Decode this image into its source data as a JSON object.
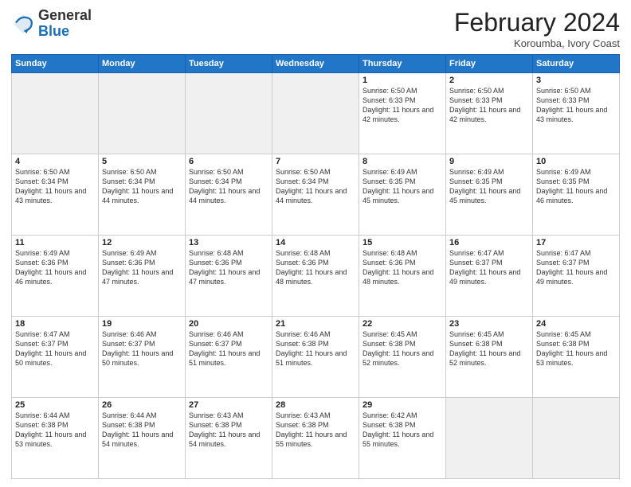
{
  "logo": {
    "general": "General",
    "blue": "Blue"
  },
  "header": {
    "month": "February 2024",
    "location": "Koroumba, Ivory Coast"
  },
  "days_of_week": [
    "Sunday",
    "Monday",
    "Tuesday",
    "Wednesday",
    "Thursday",
    "Friday",
    "Saturday"
  ],
  "weeks": [
    [
      {
        "day": "",
        "empty": true
      },
      {
        "day": "",
        "empty": true
      },
      {
        "day": "",
        "empty": true
      },
      {
        "day": "",
        "empty": true
      },
      {
        "day": "1",
        "sunrise": "6:50 AM",
        "sunset": "6:33 PM",
        "daylight": "11 hours and 42 minutes."
      },
      {
        "day": "2",
        "sunrise": "6:50 AM",
        "sunset": "6:33 PM",
        "daylight": "11 hours and 42 minutes."
      },
      {
        "day": "3",
        "sunrise": "6:50 AM",
        "sunset": "6:33 PM",
        "daylight": "11 hours and 43 minutes."
      }
    ],
    [
      {
        "day": "4",
        "sunrise": "6:50 AM",
        "sunset": "6:34 PM",
        "daylight": "11 hours and 43 minutes."
      },
      {
        "day": "5",
        "sunrise": "6:50 AM",
        "sunset": "6:34 PM",
        "daylight": "11 hours and 44 minutes."
      },
      {
        "day": "6",
        "sunrise": "6:50 AM",
        "sunset": "6:34 PM",
        "daylight": "11 hours and 44 minutes."
      },
      {
        "day": "7",
        "sunrise": "6:50 AM",
        "sunset": "6:34 PM",
        "daylight": "11 hours and 44 minutes."
      },
      {
        "day": "8",
        "sunrise": "6:49 AM",
        "sunset": "6:35 PM",
        "daylight": "11 hours and 45 minutes."
      },
      {
        "day": "9",
        "sunrise": "6:49 AM",
        "sunset": "6:35 PM",
        "daylight": "11 hours and 45 minutes."
      },
      {
        "day": "10",
        "sunrise": "6:49 AM",
        "sunset": "6:35 PM",
        "daylight": "11 hours and 46 minutes."
      }
    ],
    [
      {
        "day": "11",
        "sunrise": "6:49 AM",
        "sunset": "6:36 PM",
        "daylight": "11 hours and 46 minutes."
      },
      {
        "day": "12",
        "sunrise": "6:49 AM",
        "sunset": "6:36 PM",
        "daylight": "11 hours and 47 minutes."
      },
      {
        "day": "13",
        "sunrise": "6:48 AM",
        "sunset": "6:36 PM",
        "daylight": "11 hours and 47 minutes."
      },
      {
        "day": "14",
        "sunrise": "6:48 AM",
        "sunset": "6:36 PM",
        "daylight": "11 hours and 48 minutes."
      },
      {
        "day": "15",
        "sunrise": "6:48 AM",
        "sunset": "6:36 PM",
        "daylight": "11 hours and 48 minutes."
      },
      {
        "day": "16",
        "sunrise": "6:47 AM",
        "sunset": "6:37 PM",
        "daylight": "11 hours and 49 minutes."
      },
      {
        "day": "17",
        "sunrise": "6:47 AM",
        "sunset": "6:37 PM",
        "daylight": "11 hours and 49 minutes."
      }
    ],
    [
      {
        "day": "18",
        "sunrise": "6:47 AM",
        "sunset": "6:37 PM",
        "daylight": "11 hours and 50 minutes."
      },
      {
        "day": "19",
        "sunrise": "6:46 AM",
        "sunset": "6:37 PM",
        "daylight": "11 hours and 50 minutes."
      },
      {
        "day": "20",
        "sunrise": "6:46 AM",
        "sunset": "6:37 PM",
        "daylight": "11 hours and 51 minutes."
      },
      {
        "day": "21",
        "sunrise": "6:46 AM",
        "sunset": "6:38 PM",
        "daylight": "11 hours and 51 minutes."
      },
      {
        "day": "22",
        "sunrise": "6:45 AM",
        "sunset": "6:38 PM",
        "daylight": "11 hours and 52 minutes."
      },
      {
        "day": "23",
        "sunrise": "6:45 AM",
        "sunset": "6:38 PM",
        "daylight": "11 hours and 52 minutes."
      },
      {
        "day": "24",
        "sunrise": "6:45 AM",
        "sunset": "6:38 PM",
        "daylight": "11 hours and 53 minutes."
      }
    ],
    [
      {
        "day": "25",
        "sunrise": "6:44 AM",
        "sunset": "6:38 PM",
        "daylight": "11 hours and 53 minutes."
      },
      {
        "day": "26",
        "sunrise": "6:44 AM",
        "sunset": "6:38 PM",
        "daylight": "11 hours and 54 minutes."
      },
      {
        "day": "27",
        "sunrise": "6:43 AM",
        "sunset": "6:38 PM",
        "daylight": "11 hours and 54 minutes."
      },
      {
        "day": "28",
        "sunrise": "6:43 AM",
        "sunset": "6:38 PM",
        "daylight": "11 hours and 55 minutes."
      },
      {
        "day": "29",
        "sunrise": "6:42 AM",
        "sunset": "6:38 PM",
        "daylight": "11 hours and 55 minutes."
      },
      {
        "day": "",
        "empty": true
      },
      {
        "day": "",
        "empty": true
      }
    ]
  ]
}
